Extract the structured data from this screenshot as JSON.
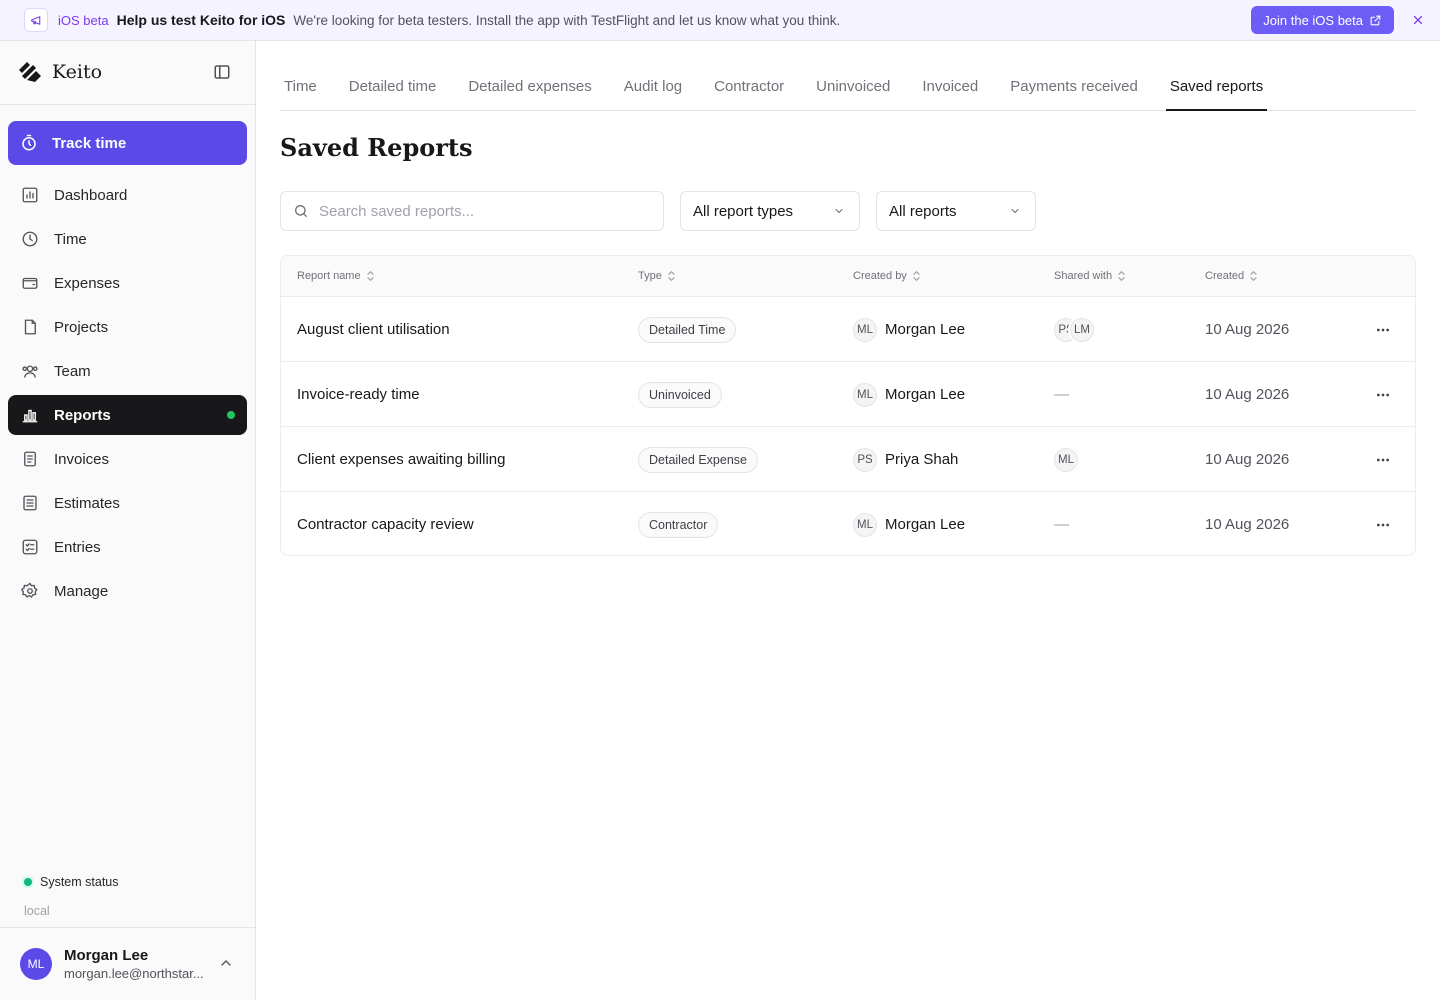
{
  "banner": {
    "icon": "megaphone-icon",
    "tag": "iOS beta",
    "title": "Help us test Keito for iOS",
    "text": "We're looking for beta testers. Install the app with TestFlight and let us know what you think.",
    "button_label": "Join the iOS beta",
    "button_icon": "external-link-icon",
    "close_icon": "close-icon"
  },
  "sidebar": {
    "brand": "Keito",
    "track_label": "Track time",
    "items": [
      {
        "label": "Dashboard",
        "icon": "dashboard-icon"
      },
      {
        "label": "Time",
        "icon": "clock-icon"
      },
      {
        "label": "Expenses",
        "icon": "wallet-icon"
      },
      {
        "label": "Projects",
        "icon": "folder-icon"
      },
      {
        "label": "Team",
        "icon": "team-icon"
      },
      {
        "label": "Reports",
        "icon": "bar-chart-icon",
        "active": true
      },
      {
        "label": "Invoices",
        "icon": "invoice-icon"
      },
      {
        "label": "Estimates",
        "icon": "estimate-icon"
      },
      {
        "label": "Entries",
        "icon": "entries-icon"
      },
      {
        "label": "Manage",
        "icon": "gear-icon"
      }
    ],
    "status_label": "System status",
    "environment": "local",
    "user": {
      "initials": "ML",
      "name": "Morgan Lee",
      "email": "morgan.lee@northstar..."
    }
  },
  "tabs": [
    "Time",
    "Detailed time",
    "Detailed expenses",
    "Audit log",
    "Contractor",
    "Uninvoiced",
    "Invoiced",
    "Payments received",
    "Saved reports"
  ],
  "active_tab": "Saved reports",
  "page_title": "Saved Reports",
  "search": {
    "placeholder": "Search saved reports..."
  },
  "filters": {
    "type": "All report types",
    "scope": "All reports"
  },
  "table": {
    "headers": [
      "Report name",
      "Type",
      "Created by",
      "Shared with",
      "Created"
    ],
    "rows": [
      {
        "name": "August client utilisation",
        "type": "Detailed Time",
        "creator_initials": "ML",
        "creator": "Morgan Lee",
        "shared": [
          "PS",
          "LM"
        ],
        "created": "10 Aug 2026"
      },
      {
        "name": "Invoice-ready time",
        "type": "Uninvoiced",
        "creator_initials": "ML",
        "creator": "Morgan Lee",
        "shared": [],
        "shared_empty": "—",
        "created": "10 Aug 2026"
      },
      {
        "name": "Client expenses awaiting billing",
        "type": "Detailed Expense",
        "creator_initials": "PS",
        "creator": "Priya Shah",
        "shared": [
          "ML"
        ],
        "created": "10 Aug 2026"
      },
      {
        "name": "Contractor capacity review",
        "type": "Contractor",
        "creator_initials": "ML",
        "creator": "Morgan Lee",
        "shared": [],
        "shared_empty": "—",
        "created": "10 Aug 2026"
      }
    ]
  },
  "colors": {
    "accent": "#5b4ae8",
    "banner_bg": "#f5f3ff",
    "active_nav": "#18181b",
    "status_ok": "#10b981"
  }
}
